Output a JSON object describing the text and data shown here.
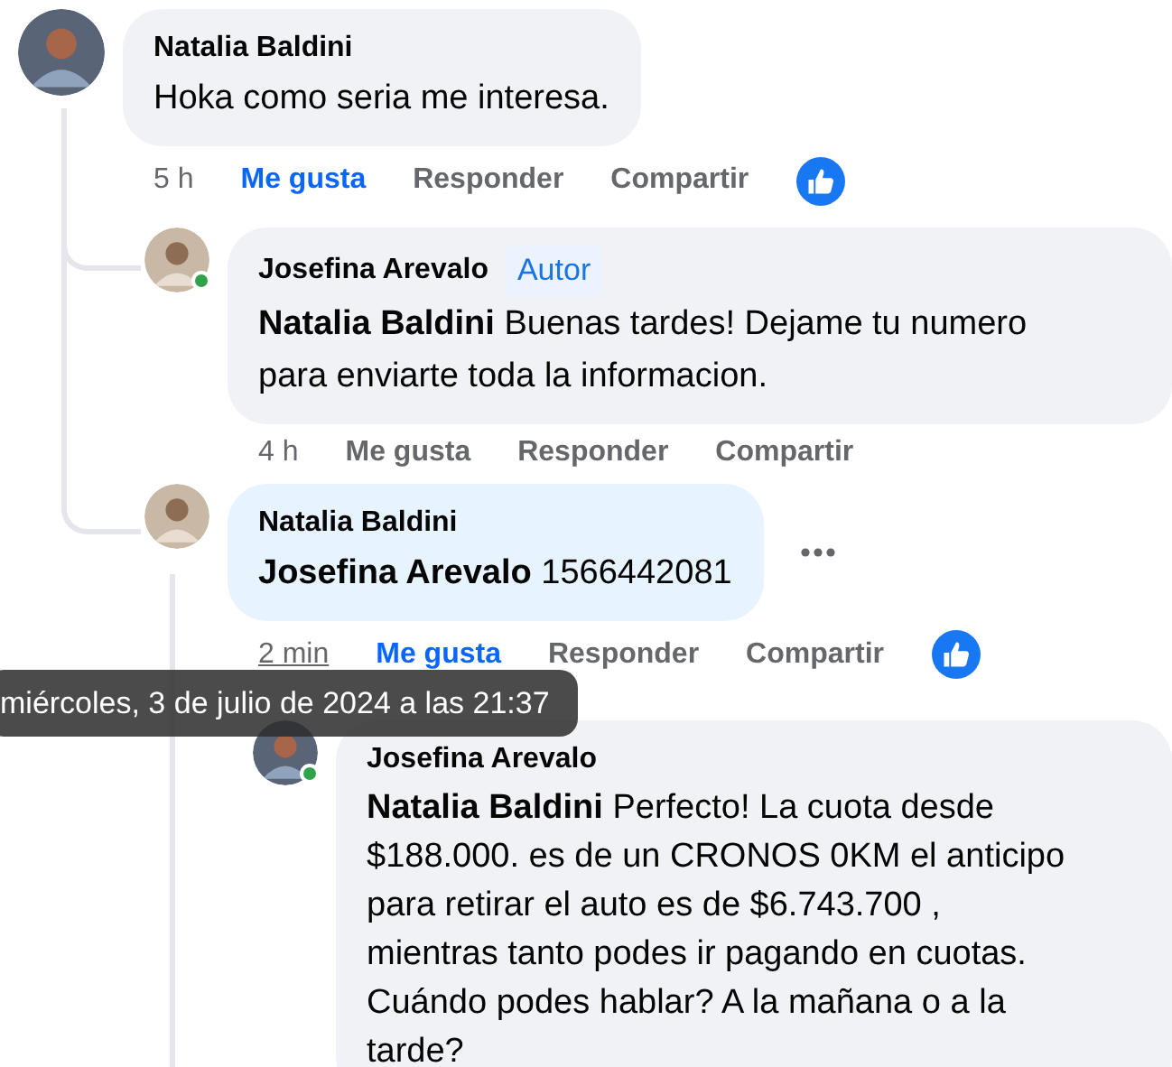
{
  "comments": [
    {
      "author": "Natalia Baldini",
      "text": "Hoka como seria me interesa.",
      "time": "5 h",
      "time_hovered": false,
      "liked": true,
      "actions": [
        "Me gusta",
        "Responder",
        "Compartir"
      ],
      "reaction": true,
      "replies": [
        {
          "author": "Josefina Arevalo",
          "badge": "Autor",
          "online": true,
          "text": "**Natalia Baldini** Buenas tardes! Dejame tu numero para enviarte toda la informacion.",
          "time": "4 h",
          "time_hovered": false,
          "liked": false,
          "actions": [
            "Me gusta",
            "Responder",
            "Compartir"
          ]
        },
        {
          "author": "Natalia Baldini",
          "text": "**Josefina Arevalo** 1566442081",
          "highlighted": true,
          "time": "2 min",
          "time_hovered": true,
          "liked": true,
          "actions": [
            "Me gusta",
            "Responder",
            "Compartir"
          ],
          "reaction": true,
          "menu_visible": true,
          "replies": [
            {
              "author": "Josefina Arevalo",
              "online": true,
              "text": "**Natalia Baldini** Perfecto! La cuota desde $188.000. es de un CRONOS 0KM el anticipo para retirar el auto es de $6.743.700 , mientras tanto podes ir pagando en cuotas. Cuándo podes hablar? A la mañana o a la tarde?"
            }
          ]
        }
      ]
    }
  ],
  "tooltip": {
    "text": "miércoles, 3 de julio de 2024 a las 21:37"
  }
}
